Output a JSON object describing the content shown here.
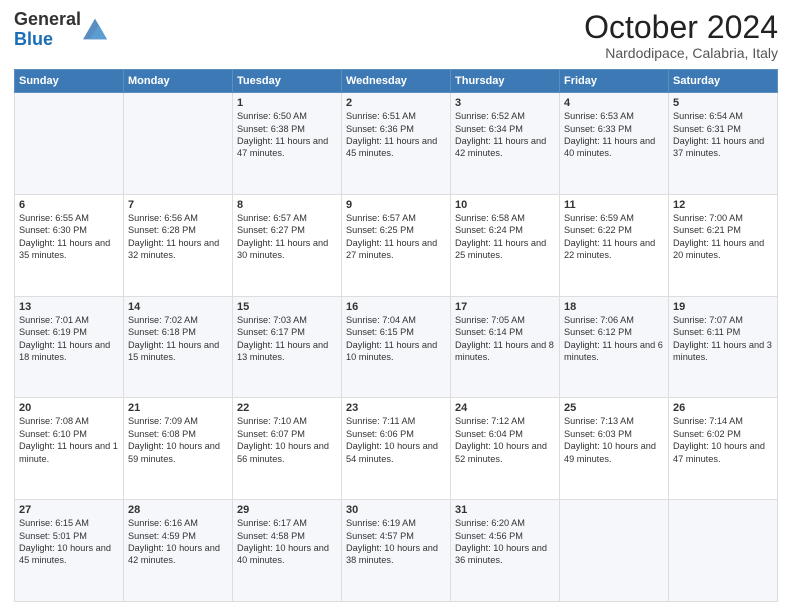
{
  "header": {
    "logo_general": "General",
    "logo_blue": "Blue",
    "month_title": "October 2024",
    "location": "Nardodipace, Calabria, Italy"
  },
  "days_of_week": [
    "Sunday",
    "Monday",
    "Tuesday",
    "Wednesday",
    "Thursday",
    "Friday",
    "Saturday"
  ],
  "weeks": [
    [
      {
        "day": "",
        "content": ""
      },
      {
        "day": "",
        "content": ""
      },
      {
        "day": "1",
        "content": "Sunrise: 6:50 AM\nSunset: 6:38 PM\nDaylight: 11 hours and 47 minutes."
      },
      {
        "day": "2",
        "content": "Sunrise: 6:51 AM\nSunset: 6:36 PM\nDaylight: 11 hours and 45 minutes."
      },
      {
        "day": "3",
        "content": "Sunrise: 6:52 AM\nSunset: 6:34 PM\nDaylight: 11 hours and 42 minutes."
      },
      {
        "day": "4",
        "content": "Sunrise: 6:53 AM\nSunset: 6:33 PM\nDaylight: 11 hours and 40 minutes."
      },
      {
        "day": "5",
        "content": "Sunrise: 6:54 AM\nSunset: 6:31 PM\nDaylight: 11 hours and 37 minutes."
      }
    ],
    [
      {
        "day": "6",
        "content": "Sunrise: 6:55 AM\nSunset: 6:30 PM\nDaylight: 11 hours and 35 minutes."
      },
      {
        "day": "7",
        "content": "Sunrise: 6:56 AM\nSunset: 6:28 PM\nDaylight: 11 hours and 32 minutes."
      },
      {
        "day": "8",
        "content": "Sunrise: 6:57 AM\nSunset: 6:27 PM\nDaylight: 11 hours and 30 minutes."
      },
      {
        "day": "9",
        "content": "Sunrise: 6:57 AM\nSunset: 6:25 PM\nDaylight: 11 hours and 27 minutes."
      },
      {
        "day": "10",
        "content": "Sunrise: 6:58 AM\nSunset: 6:24 PM\nDaylight: 11 hours and 25 minutes."
      },
      {
        "day": "11",
        "content": "Sunrise: 6:59 AM\nSunset: 6:22 PM\nDaylight: 11 hours and 22 minutes."
      },
      {
        "day": "12",
        "content": "Sunrise: 7:00 AM\nSunset: 6:21 PM\nDaylight: 11 hours and 20 minutes."
      }
    ],
    [
      {
        "day": "13",
        "content": "Sunrise: 7:01 AM\nSunset: 6:19 PM\nDaylight: 11 hours and 18 minutes."
      },
      {
        "day": "14",
        "content": "Sunrise: 7:02 AM\nSunset: 6:18 PM\nDaylight: 11 hours and 15 minutes."
      },
      {
        "day": "15",
        "content": "Sunrise: 7:03 AM\nSunset: 6:17 PM\nDaylight: 11 hours and 13 minutes."
      },
      {
        "day": "16",
        "content": "Sunrise: 7:04 AM\nSunset: 6:15 PM\nDaylight: 11 hours and 10 minutes."
      },
      {
        "day": "17",
        "content": "Sunrise: 7:05 AM\nSunset: 6:14 PM\nDaylight: 11 hours and 8 minutes."
      },
      {
        "day": "18",
        "content": "Sunrise: 7:06 AM\nSunset: 6:12 PM\nDaylight: 11 hours and 6 minutes."
      },
      {
        "day": "19",
        "content": "Sunrise: 7:07 AM\nSunset: 6:11 PM\nDaylight: 11 hours and 3 minutes."
      }
    ],
    [
      {
        "day": "20",
        "content": "Sunrise: 7:08 AM\nSunset: 6:10 PM\nDaylight: 11 hours and 1 minute."
      },
      {
        "day": "21",
        "content": "Sunrise: 7:09 AM\nSunset: 6:08 PM\nDaylight: 10 hours and 59 minutes."
      },
      {
        "day": "22",
        "content": "Sunrise: 7:10 AM\nSunset: 6:07 PM\nDaylight: 10 hours and 56 minutes."
      },
      {
        "day": "23",
        "content": "Sunrise: 7:11 AM\nSunset: 6:06 PM\nDaylight: 10 hours and 54 minutes."
      },
      {
        "day": "24",
        "content": "Sunrise: 7:12 AM\nSunset: 6:04 PM\nDaylight: 10 hours and 52 minutes."
      },
      {
        "day": "25",
        "content": "Sunrise: 7:13 AM\nSunset: 6:03 PM\nDaylight: 10 hours and 49 minutes."
      },
      {
        "day": "26",
        "content": "Sunrise: 7:14 AM\nSunset: 6:02 PM\nDaylight: 10 hours and 47 minutes."
      }
    ],
    [
      {
        "day": "27",
        "content": "Sunrise: 6:15 AM\nSunset: 5:01 PM\nDaylight: 10 hours and 45 minutes."
      },
      {
        "day": "28",
        "content": "Sunrise: 6:16 AM\nSunset: 4:59 PM\nDaylight: 10 hours and 42 minutes."
      },
      {
        "day": "29",
        "content": "Sunrise: 6:17 AM\nSunset: 4:58 PM\nDaylight: 10 hours and 40 minutes."
      },
      {
        "day": "30",
        "content": "Sunrise: 6:19 AM\nSunset: 4:57 PM\nDaylight: 10 hours and 38 minutes."
      },
      {
        "day": "31",
        "content": "Sunrise: 6:20 AM\nSunset: 4:56 PM\nDaylight: 10 hours and 36 minutes."
      },
      {
        "day": "",
        "content": ""
      },
      {
        "day": "",
        "content": ""
      }
    ]
  ]
}
